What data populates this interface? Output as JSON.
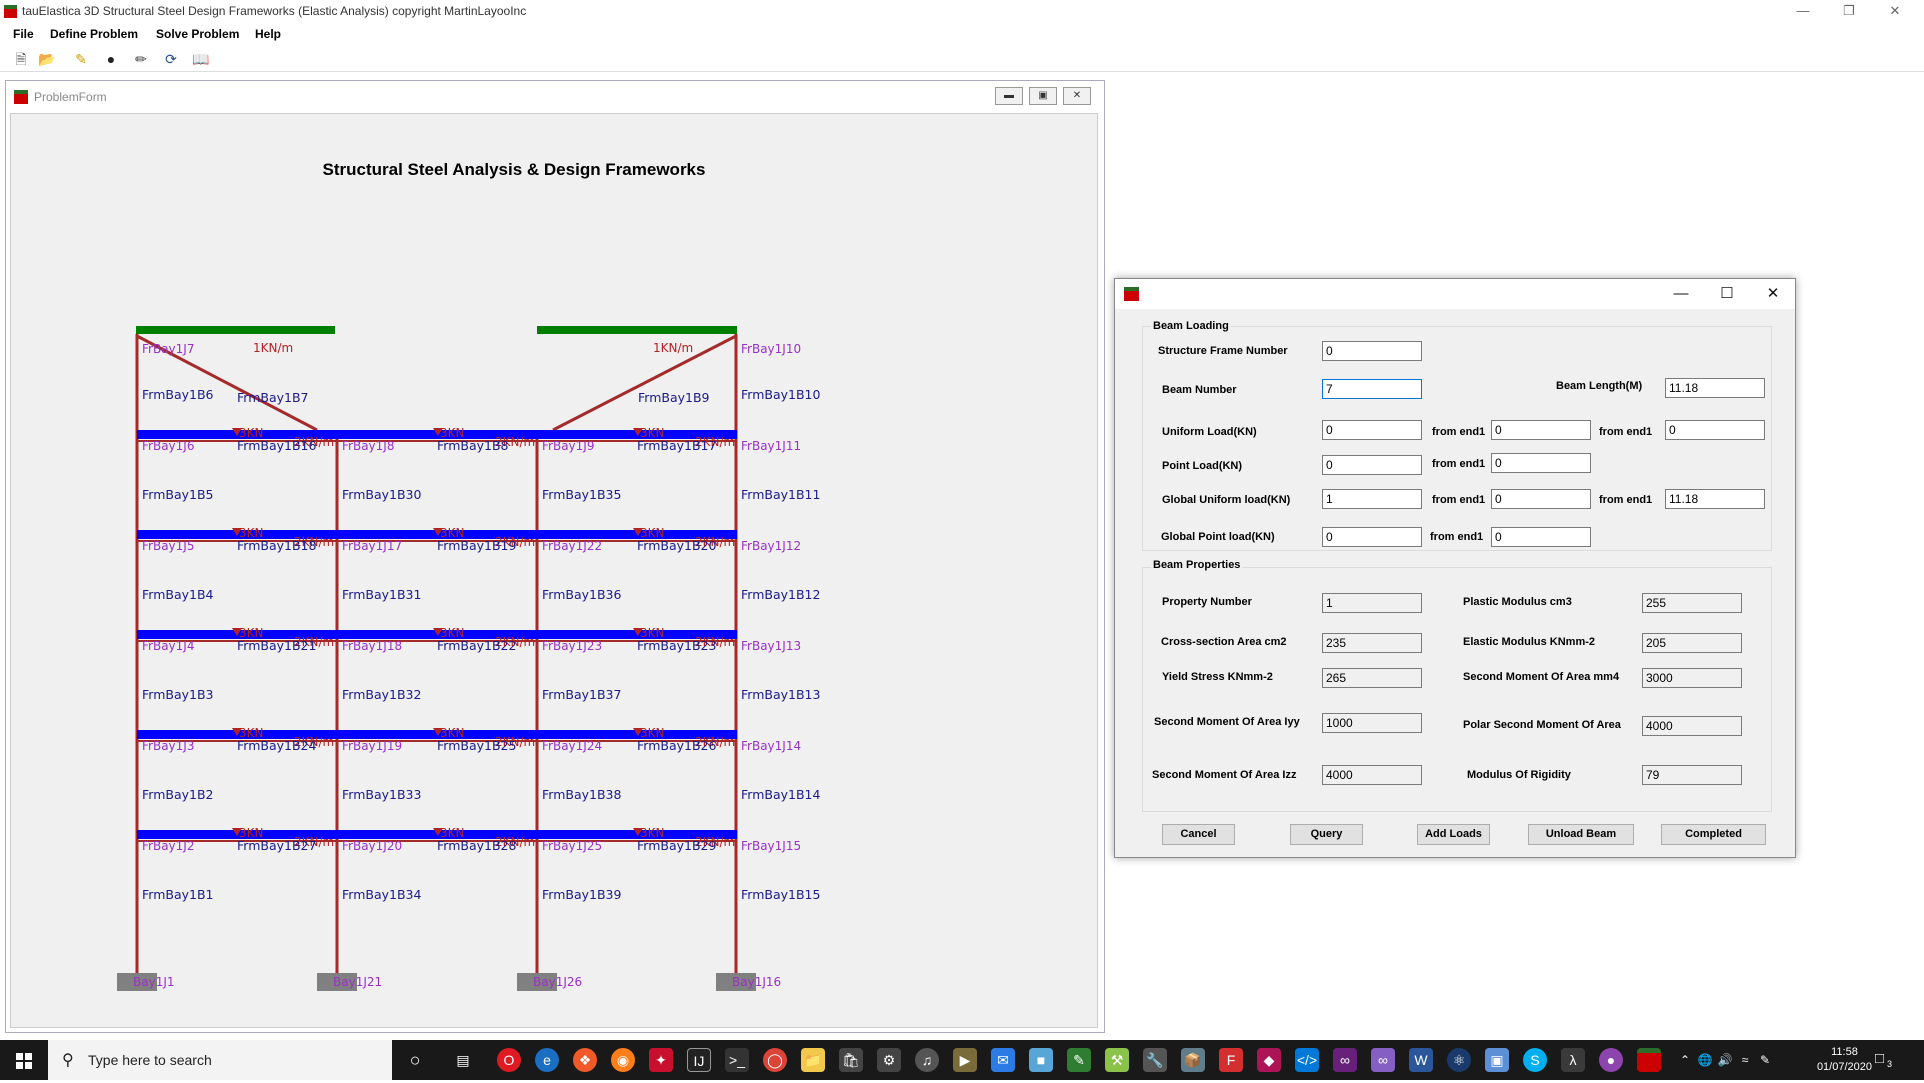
{
  "app": {
    "title": "tauElastica 3D Structural Steel Design Frameworks (Elastic Analysis) copyright MartinLayooInc",
    "menu": [
      "File",
      "Define Problem",
      "Solve Problem",
      "Help"
    ]
  },
  "problem_form": {
    "title": "ProblemForm",
    "heading": "Structural Steel Analysis & Design Frameworks"
  },
  "frame": {
    "load_label_udl": "1KN/m",
    "load_label_point": "3KN",
    "load_label_beam": "2KN/m",
    "column_labels": [
      {
        "text": "FrmBay1B6",
        "col": 0,
        "row": 0
      },
      {
        "text": "FrmBay1B5",
        "col": 0,
        "row": 1
      },
      {
        "text": "FrmBay1B4",
        "col": 0,
        "row": 2
      },
      {
        "text": "FrmBay1B3",
        "col": 0,
        "row": 3
      },
      {
        "text": "FrmBay1B2",
        "col": 0,
        "row": 4
      },
      {
        "text": "FrmBay1B1",
        "col": 0,
        "row": 5
      },
      {
        "text": "FrmBay1B30",
        "col": 1,
        "row": 1
      },
      {
        "text": "FrmBay1B31",
        "col": 1,
        "row": 2
      },
      {
        "text": "FrmBay1B32",
        "col": 1,
        "row": 3
      },
      {
        "text": "FrmBay1B33",
        "col": 1,
        "row": 4
      },
      {
        "text": "FrmBay1B34",
        "col": 1,
        "row": 5
      },
      {
        "text": "FrmBay1B35",
        "col": 2,
        "row": 1
      },
      {
        "text": "FrmBay1B36",
        "col": 2,
        "row": 2
      },
      {
        "text": "FrmBay1B37",
        "col": 2,
        "row": 3
      },
      {
        "text": "FrmBay1B38",
        "col": 2,
        "row": 4
      },
      {
        "text": "FrmBay1B39",
        "col": 2,
        "row": 5
      },
      {
        "text": "FrmBay1B10",
        "col": 3,
        "row": 0
      },
      {
        "text": "FrmBay1B11",
        "col": 3,
        "row": 1
      },
      {
        "text": "FrmBay1B12",
        "col": 3,
        "row": 2
      },
      {
        "text": "FrmBay1B13",
        "col": 3,
        "row": 3
      },
      {
        "text": "FrmBay1B14",
        "col": 3,
        "row": 4
      },
      {
        "text": "FrmBay1B15",
        "col": 3,
        "row": 5
      }
    ],
    "rafter_labels": [
      "FrmBay1B7",
      "FrmBay1B9"
    ],
    "joint_labels": [
      {
        "text": "FrBay1J7",
        "col": 0,
        "row": 0
      },
      {
        "text": "FrBay1J10",
        "col": 3,
        "row": 0
      },
      {
        "text": "FrBay1J6",
        "col": 0,
        "row": 1
      },
      {
        "text": "FrBay1J8",
        "col": 1,
        "row": 1
      },
      {
        "text": "FrBay1J9",
        "col": 2,
        "row": 1
      },
      {
        "text": "FrBay1J11",
        "col": 3,
        "row": 1
      },
      {
        "text": "FrBay1J5",
        "col": 0,
        "row": 2
      },
      {
        "text": "FrBay1J17",
        "col": 1,
        "row": 2
      },
      {
        "text": "FrBay1J22",
        "col": 2,
        "row": 2
      },
      {
        "text": "FrBay1J12",
        "col": 3,
        "row": 2
      },
      {
        "text": "FrBay1J4",
        "col": 0,
        "row": 3
      },
      {
        "text": "FrBay1J18",
        "col": 1,
        "row": 3
      },
      {
        "text": "FrBay1J23",
        "col": 2,
        "row": 3
      },
      {
        "text": "FrBay1J13",
        "col": 3,
        "row": 3
      },
      {
        "text": "FrBay1J3",
        "col": 0,
        "row": 4
      },
      {
        "text": "FrBay1J19",
        "col": 1,
        "row": 4
      },
      {
        "text": "FrBay1J24",
        "col": 2,
        "row": 4
      },
      {
        "text": "FrBay1J14",
        "col": 3,
        "row": 4
      },
      {
        "text": "FrBay1J2",
        "col": 0,
        "row": 5
      },
      {
        "text": "FrBay1J20",
        "col": 1,
        "row": 5
      },
      {
        "text": "FrBay1J25",
        "col": 2,
        "row": 5
      },
      {
        "text": "FrBay1J15",
        "col": 3,
        "row": 5
      }
    ],
    "beam_labels": [
      {
        "text": "FrmBay1B16",
        "col": 0,
        "row": 1
      },
      {
        "text": "FrmBay1B8",
        "col": 1,
        "row": 1
      },
      {
        "text": "FrmBay1B17",
        "col": 2,
        "row": 1
      },
      {
        "text": "FrmBay1B18",
        "col": 0,
        "row": 2
      },
      {
        "text": "FrmBay1B19",
        "col": 1,
        "row": 2
      },
      {
        "text": "FrmBay1B20",
        "col": 2,
        "row": 2
      },
      {
        "text": "FrmBay1B21",
        "col": 0,
        "row": 3
      },
      {
        "text": "FrmBay1B22",
        "col": 1,
        "row": 3
      },
      {
        "text": "FrmBay1B23",
        "col": 2,
        "row": 3
      },
      {
        "text": "FrmBay1B24",
        "col": 0,
        "row": 4
      },
      {
        "text": "FrmBay1B25",
        "col": 1,
        "row": 4
      },
      {
        "text": "FrmBay1B26",
        "col": 2,
        "row": 4
      },
      {
        "text": "FrmBay1B27",
        "col": 0,
        "row": 5
      },
      {
        "text": "FrmBay1B28",
        "col": 1,
        "row": 5
      },
      {
        "text": "FrmBay1B29",
        "col": 2,
        "row": 5
      }
    ],
    "support_labels": [
      "Bay1J1",
      "Bay1J21",
      "Bay1J26",
      "Bay1J16"
    ],
    "colors": {
      "column": "#a52a2a",
      "beam": "#0000ff",
      "roof": "#008000",
      "support": "#808080",
      "load": "#b22222",
      "joint_text": "#9b30c8",
      "member_text": "#1a1a8c"
    }
  },
  "dialog": {
    "group_loading": "Beam Loading",
    "group_properties": "Beam Properties",
    "structure_frame_number": {
      "label": "Structure Frame Number",
      "value": "0"
    },
    "beam_number": {
      "label": "Beam Number",
      "value": "7"
    },
    "beam_length": {
      "label": "Beam Length(M)",
      "value": "11.18"
    },
    "uniform_load": {
      "label": "Uniform Load(KN)",
      "value": "0",
      "from1_label": "from end1",
      "from1": "0",
      "from2_label": "from end1",
      "from2": "0"
    },
    "point_load": {
      "label": "Point Load(KN)",
      "value": "0",
      "from1_label": "from end1",
      "from1": "0"
    },
    "global_uniform_load": {
      "label": "Global Uniform load(KN)",
      "value": "1",
      "from1_label": "from end1",
      "from1": "0",
      "from2_label": "from end1",
      "from2": "11.18"
    },
    "global_point_load": {
      "label": "Global Point load(KN)",
      "value": "0",
      "from1_label": "from end1",
      "from1": "0"
    },
    "property_number": {
      "label": "Property Number",
      "value": "1"
    },
    "plastic_modulus": {
      "label": "Plastic Modulus cm3",
      "value": "255"
    },
    "cross_section_area": {
      "label": "Cross-section Area cm2",
      "value": "235"
    },
    "elastic_modulus": {
      "label": "Elastic Modulus KNmm-2",
      "value": "205"
    },
    "yield_stress": {
      "label": "Yield Stress KNmm-2",
      "value": "265"
    },
    "second_moment_area_mm4": {
      "label": "Second Moment Of Area mm4",
      "value": "3000"
    },
    "second_moment_iyy": {
      "label": "Second Moment Of Area Iyy",
      "value": "1000"
    },
    "polar_second_moment": {
      "label": "Polar Second Moment Of Area",
      "value": "4000"
    },
    "second_moment_izz": {
      "label": "Second Moment Of Area Izz",
      "value": "4000"
    },
    "modulus_rigidity": {
      "label": "Modulus Of Rigidity",
      "value": "79"
    },
    "buttons": {
      "cancel": "Cancel",
      "query": "Query",
      "add_loads": "Add Loads",
      "unload_beam": "Unload Beam",
      "completed": "Completed"
    }
  },
  "taskbar": {
    "search_placeholder": "Type here to search",
    "time": "11:58",
    "date": "01/07/2020",
    "notification_count": "3"
  }
}
